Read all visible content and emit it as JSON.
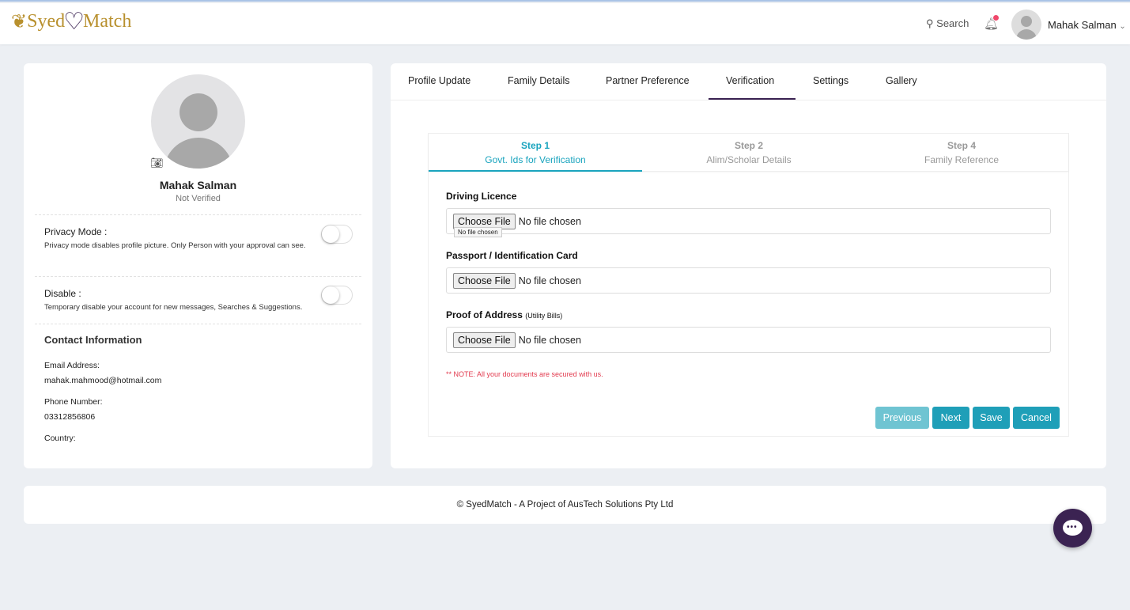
{
  "header": {
    "logo": "SyedMatch",
    "search_label": "Search",
    "user_name": "Mahak Salman",
    "chevron": "⌄",
    "notification_dot_color": "#f0476b"
  },
  "profile": {
    "name": "Mahak Salman",
    "status": "Not Verified",
    "privacy": {
      "label": "Privacy Mode :",
      "desc": "Privacy mode disables profile picture. Only Person with your approval can see.",
      "enabled": false
    },
    "disable": {
      "label": "Disable :",
      "desc": "Temporary disable your account for new messages, Searches & Suggestions.",
      "enabled": false
    },
    "contact": {
      "title": "Contact Information",
      "email_label": "Email Address:",
      "email": "mahak.mahmood@hotmail.com",
      "phone_label": "Phone Number:",
      "phone": "03312856806",
      "country_label": "Country:"
    }
  },
  "tabs": [
    {
      "label": "Profile Update"
    },
    {
      "label": "Family Details"
    },
    {
      "label": "Partner Preference"
    },
    {
      "label": "Verification",
      "active": true
    },
    {
      "label": "Settings"
    },
    {
      "label": "Gallery"
    }
  ],
  "wizard": {
    "steps": [
      {
        "title": "Step 1",
        "subtitle": "Govt. Ids for Verification",
        "active": true
      },
      {
        "title": "Step 2",
        "subtitle": "Alim/Scholar Details"
      },
      {
        "title": "Step 4",
        "subtitle": "Family Reference"
      }
    ],
    "fields": [
      {
        "label": "Driving Licence",
        "button": "Choose File",
        "value": "No file chosen"
      },
      {
        "label": "Passport / Identification Card",
        "button": "Choose File",
        "value": "No file chosen"
      },
      {
        "label": "Proof of Address",
        "sub": "(Utility Bills)",
        "button": "Choose File",
        "value": "No file chosen"
      }
    ],
    "tooltip": "No file chosen",
    "note": "** NOTE: All your documents are secured with us.",
    "buttons": {
      "previous": "Previous",
      "next": "Next",
      "save": "Save",
      "cancel": "Cancel"
    },
    "accent": "#1aa4be"
  },
  "footer": {
    "text": "© SyedMatch - A Project of AusTech Solutions Pty Ltd"
  }
}
